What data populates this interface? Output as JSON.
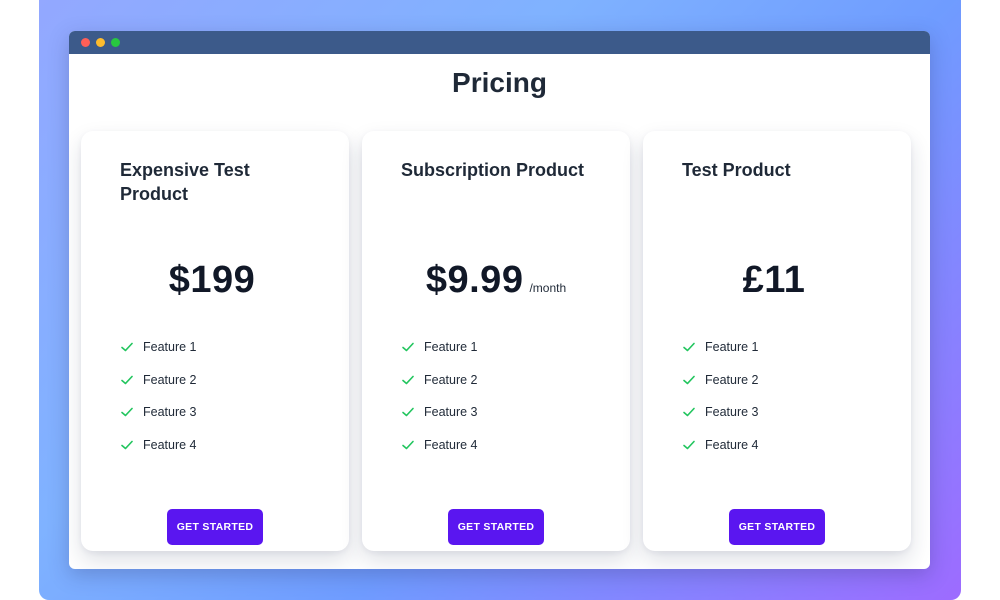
{
  "window": {
    "controls": [
      {
        "name": "close",
        "color": "#ff5f57"
      },
      {
        "name": "minimize",
        "color": "#febc2e"
      },
      {
        "name": "maximize",
        "color": "#28c840"
      }
    ]
  },
  "page": {
    "title": "Pricing"
  },
  "products": [
    {
      "name": "Expensive Test Product",
      "price": "$199",
      "period": "",
      "features": [
        "Feature 1",
        "Feature 2",
        "Feature 3",
        "Feature 4"
      ],
      "cta": "GET STARTED"
    },
    {
      "name": "Subscription Product",
      "price": "$9.99",
      "period": "/month",
      "features": [
        "Feature 1",
        "Feature 2",
        "Feature 3",
        "Feature 4"
      ],
      "cta": "GET STARTED"
    },
    {
      "name": "Test Product",
      "price": "£11",
      "period": "",
      "features": [
        "Feature 1",
        "Feature 2",
        "Feature 3",
        "Feature 4"
      ],
      "cta": "GET STARTED"
    }
  ],
  "colors": {
    "accent": "#5a16f0",
    "check": "#22c55e"
  },
  "icons": {
    "feature": "check-icon"
  }
}
